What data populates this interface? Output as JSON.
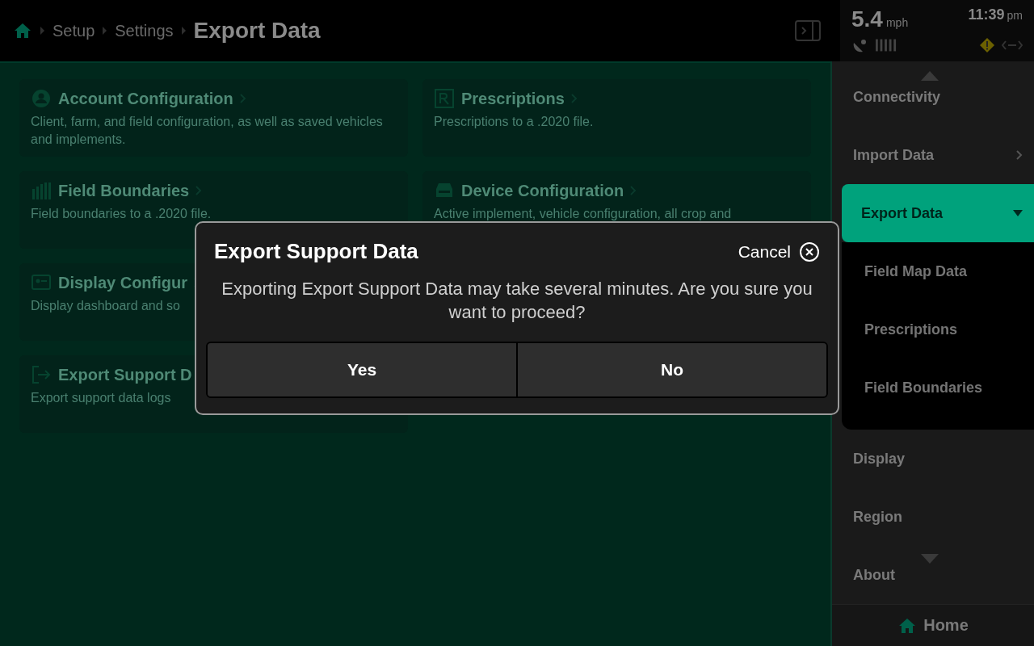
{
  "header": {
    "breadcrumb": [
      {
        "label": "Setup"
      },
      {
        "label": "Settings"
      }
    ],
    "title": "Export Data",
    "speed": "5.4",
    "speed_unit": "mph",
    "time": "11:39",
    "time_unit": "pm"
  },
  "card_columns": [
    {
      "cards": [
        {
          "kind": "account",
          "title": "Account Configuration",
          "description": "Client, farm, and field configuration, as well as saved vehicles and implements."
        },
        {
          "kind": "boundaries",
          "title": "Field Boundaries",
          "description": "Field boundaries to a .2020 file."
        },
        {
          "kind": "display",
          "title": "Display Configur",
          "description": "Display dashboard and so"
        },
        {
          "kind": "support",
          "title": "Export Support D",
          "description": "Export support data logs"
        }
      ]
    },
    {
      "cards": [
        {
          "kind": "prescriptions",
          "title": "Prescriptions",
          "description": "Prescriptions to a .2020 file."
        },
        {
          "kind": "device",
          "title": "Device Configuration",
          "description": "Active implement, vehicle configuration, all crop and"
        }
      ]
    }
  ],
  "sidebar": {
    "items": [
      {
        "label": "Connectivity",
        "selected": false
      },
      {
        "label": "Import Data",
        "selected": false,
        "expanded": false
      },
      {
        "label": "Export Data",
        "selected": true,
        "expanded": true,
        "children": [
          {
            "label": "Field Map Data"
          },
          {
            "label": "Prescriptions"
          },
          {
            "label": "Field Boundaries"
          }
        ]
      },
      {
        "label": "Display",
        "selected": false
      },
      {
        "label": "Region",
        "selected": false
      },
      {
        "label": "About",
        "selected": false
      }
    ],
    "home": "Home"
  },
  "dialog": {
    "title": "Export Support Data",
    "cancel": "Cancel",
    "message": "Exporting Export Support Data may take several minutes.  Are you sure you want to proceed?",
    "buttons": [
      "Yes",
      "No"
    ]
  }
}
